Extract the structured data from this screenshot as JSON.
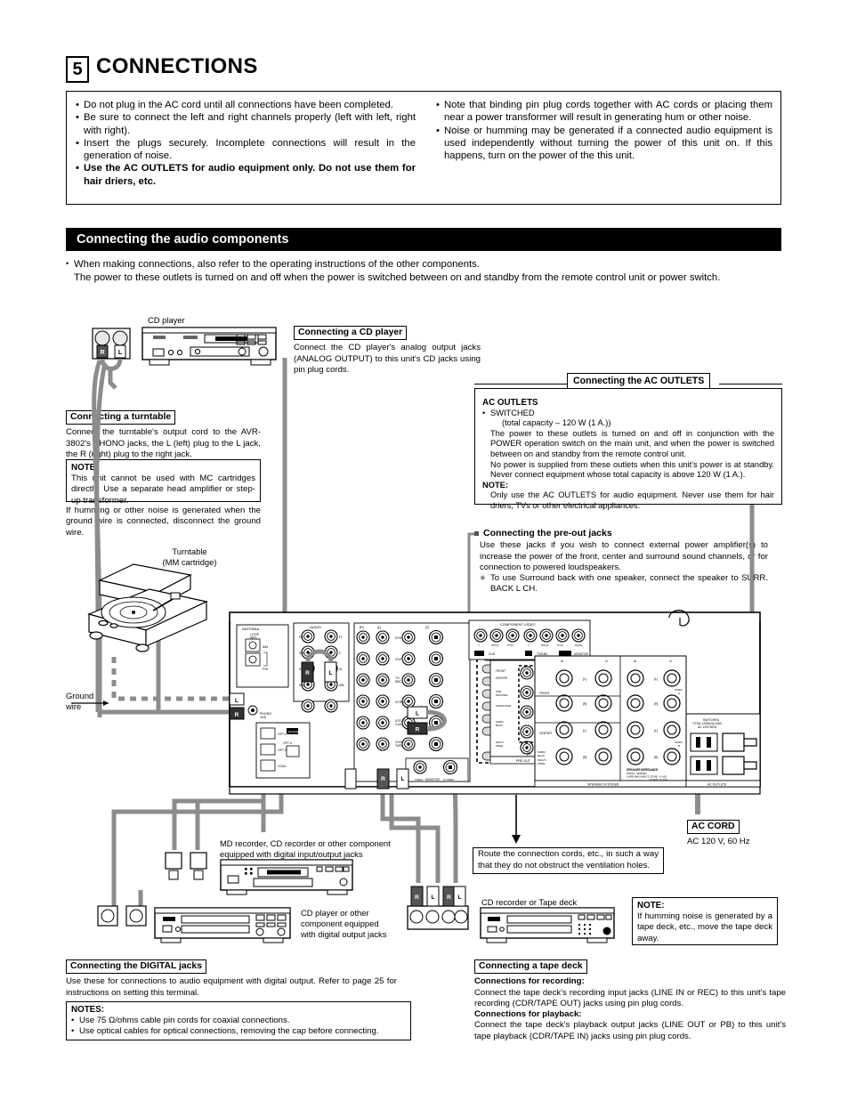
{
  "section": {
    "number": "5",
    "title": "CONNECTIONS"
  },
  "top_notes": {
    "left": [
      "Do not plug in the AC cord until all connections have been completed.",
      "Be sure to connect the left and right channels properly (left with left, right with right).",
      "Insert the plugs securely. Incomplete connections will result in the generation of noise.",
      "Use the AC OUTLETS for audio equipment only. Do not use them for hair driers, etc."
    ],
    "right": [
      "Note that binding pin plug cords together with AC cords or placing them near a power transformer will result in generating hum or other noise.",
      "Noise or humming may be generated if a connected audio equipment is used independently without turning the power of this unit on. If this happens, turn on the power of the this unit."
    ]
  },
  "band": {
    "title": "Connecting the audio components",
    "note": "When making connections, also refer to the operating instructions of the other components.",
    "note2": "The power to these outlets is turned on and off when the power is switched between on and standby from the remote control unit or power switch."
  },
  "cd_player": {
    "device_label": "CD player",
    "heading": "Connecting a CD player",
    "body": "Connect the CD player's analog output jacks (ANALOG OUTPUT) to this unit's CD jacks using pin plug cords."
  },
  "turntable": {
    "heading": "Connecting a turntable",
    "body": "Connect the turntable's output cord to the AVR-3802's PHONO jacks, the L (left) plug to the L jack, the R (right) plug to the right jack.",
    "note_title": "NOTE:",
    "note_body": "This unit cannot be used with MC cartridges directly. Use a separate head amplifier or step-up transformer.",
    "after": "If humming or other noise is generated when the ground wire is connected, disconnect the ground wire.",
    "device_label_line1": "Turntable",
    "device_label_line2": "(MM cartridge)",
    "ground_label_line1": "Ground",
    "ground_label_line2": "wire"
  },
  "ac_outlets": {
    "heading": "Connecting the AC OUTLETS",
    "title": "AC OUTLETS",
    "switched": "SWITCHED",
    "capacity": "(total capacity – 120 W (1 A.))",
    "p1": "The power to these outlets is turned on and off in conjunction with the POWER operation switch on the main unit, and when the power is switched between on and standby from the remote control unit.",
    "p2": "No power is supplied from these outlets when this unit's power is at standby. Never connect equipment whose total capacity is above 120 W (1 A.).",
    "note_title": "NOTE:",
    "note_body": "Only use the AC OUTLETS for audio equipment. Never use them for hair driers, TVs or other electrical appliances."
  },
  "pre_out": {
    "heading": "Connecting the pre-out jacks",
    "body": "Use these jacks if you wish to connect external power amplifier(s) to increase the power of the front, center and surround sound channels, or for connection to powered loudspeakers.",
    "star_symbol": "✳",
    "star_body": "To use Surround back with one speaker, connect the speaker to SURR. BACK L CH."
  },
  "ac_cord": {
    "heading": "AC CORD",
    "body": "AC 120 V, 60 Hz"
  },
  "vent_note": "Route the connection cords, etc., in such a way that they do not obstruct the ventilation holes.",
  "digital": {
    "heading": "Connecting the DIGITAL jacks",
    "body": "Use these for connections to audio equipment with digital output. Refer to page 25 for instructions on setting this terminal.",
    "notes_title": "NOTES:",
    "notes": [
      "Use 75 Ω/ohms cable pin cords for coaxial connections.",
      "Use optical cables for optical connections, removing the cap before connecting."
    ],
    "md_label_line1": "MD recorder, CD recorder or other component",
    "md_label_line2": "equipped with digital input/output jacks",
    "cd_label_line1": "CD player or other",
    "cd_label_line2": "component equipped",
    "cd_label_line3": "with digital output jacks"
  },
  "tape_deck": {
    "heading": "Connecting a tape deck",
    "rec_title": "Connections for recording:",
    "rec_body": "Connect the tape deck's recording input jacks (LINE IN or REC) to this unit's tape recording (CDR/TAPE OUT) jacks using pin plug cords.",
    "play_title": "Connections for playback:",
    "play_body": "Connect the tape deck's playback output jacks (LINE OUT or PB) to this unit's tape playback (CDR/TAPE IN) jacks using pin plug cords.",
    "device_label": "CD recorder or Tape deck",
    "note_title": "NOTE:",
    "note_body": "If humming noise is generated by a tape deck, etc., move the tape deck away."
  },
  "rear_panel": {
    "antenna": "ANTENNA",
    "loop_ant": "LOOP ANT.",
    "am": "AM",
    "fm": "FM",
    "audio": "AUDIO",
    "component_video": "COMPONENT VIDEO",
    "pre_out": "PRE OUT",
    "speaker_systems": "SPEAKER SYSTEMS",
    "ac_outlets": "AC OUTLETS",
    "switched_text_l1": "SWITCHED",
    "switched_text_l2": "TOTAL 120W(1A) MAX.",
    "switched_text_l3": "AC 120V 60Hz",
    "monitor": "MONITOR",
    "video": "VIDEO",
    "s_video": "S-VIDEO",
    "digital": "DIGITAL",
    "phono": "PHONO",
    "gnd": "GND",
    "opt_1": "OPT-1",
    "opt_2": "OPT-2",
    "coax": "COAX",
    "opt_3": "OPT-3",
    "rows_audio_left": [
      "FR",
      "FL"
    ],
    "jack_rows": [
      "DVD",
      "VDP",
      "TV/DBS",
      "VCR-1",
      "VCR-2/V.AUX",
      "CDR/TAPE"
    ],
    "pre_out_rows": [
      "FRONT",
      "CENTER",
      "SUBWOOFER",
      "SURROUND",
      "SURR. BACK",
      "MULTI ZONE"
    ],
    "speaker_rows": [
      "FRONT",
      "CENTER",
      "SURR-BACK/MULTI ZONE"
    ],
    "speaker_impedance_title": "SPEAKER IMPEDANCE",
    "speaker_impedance_l1": "FRONT, CENTER,",
    "speaker_impedance_l2": "SURR./BACK/MULTI ZONE :   6~16Ω",
    "speaker_impedance_l3": "SURROUND                 A  OR  B :  6~16Ω",
    "speaker_impedance_l4": "                                  A  +  B : 12~16Ω",
    "y": "Y",
    "pbcb": "Pb/Cb",
    "prcr": "Pr/Cr",
    "dvd": "DVD",
    "tvdbs": "TV/DBS",
    "monitor_cv": "MONITOR"
  },
  "plug_labels": {
    "r": "R",
    "l": "L"
  },
  "colors": {
    "band_bg": "#000000",
    "cable_gray": "#8c8c8c",
    "panel_fill": "#ffffff",
    "text": "#000000"
  }
}
